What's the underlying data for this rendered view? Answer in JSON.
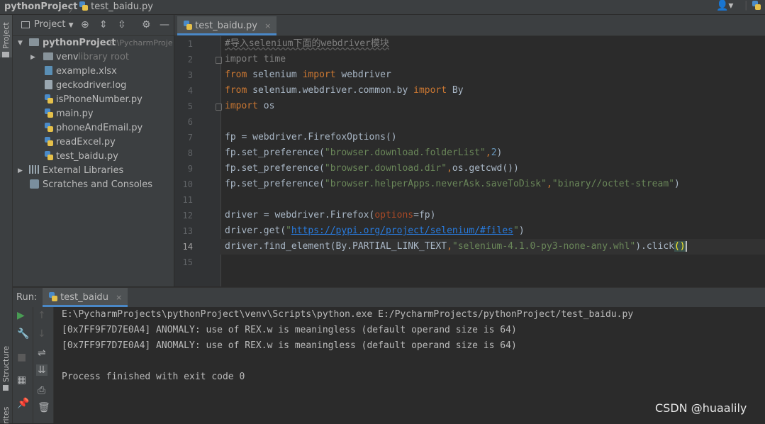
{
  "breadcrumb": {
    "project": "pythonProject",
    "file": "test_baidu.py"
  },
  "left_strip": {
    "project_tab": "Project",
    "structure_tab": "Structure",
    "favorites_tab": "rites"
  },
  "project_panel": {
    "title": "Project",
    "root": {
      "name": "pythonProject",
      "path": "E:\\PycharmProje"
    },
    "items": [
      {
        "name": "venv",
        "note": "library root",
        "type": "folder"
      },
      {
        "name": "example.xlsx",
        "type": "xlsx"
      },
      {
        "name": "geckodriver.log",
        "type": "file"
      },
      {
        "name": "isPhoneNumber.py",
        "type": "python"
      },
      {
        "name": "main.py",
        "type": "python"
      },
      {
        "name": "phoneAndEmail.py",
        "type": "python"
      },
      {
        "name": "readExcel.py",
        "type": "python"
      },
      {
        "name": "test_baidu.py",
        "type": "python"
      }
    ],
    "external_libraries": "External Libraries",
    "scratches": "Scratches and Consoles"
  },
  "editor": {
    "tab_label": "test_baidu.py",
    "tab_close": "×",
    "line_numbers": [
      "1",
      "2",
      "3",
      "4",
      "5",
      "6",
      "7",
      "8",
      "9",
      "10",
      "11",
      "12",
      "13",
      "14",
      "15"
    ],
    "current_line": "14",
    "code": {
      "l1": "#导入selenium下面的webdriver模块",
      "l2_kw": "import",
      "l2_mod": " time",
      "l3_kw1": "from",
      "l3_mod": " selenium ",
      "l3_kw2": "import",
      "l3_name": " webdriver",
      "l4_kw1": "from",
      "l4_mod": " selenium.webdriver.common.by ",
      "l4_kw2": "import",
      "l4_name": " By",
      "l5_kw": "import",
      "l5_mod": " os",
      "l7": "fp = webdriver.FirefoxOptions()",
      "l8_a": "fp.set_preference(",
      "l8_s": "\"browser.download.folderList\"",
      "l8_comma": ",",
      "l8_n": "2",
      "l8_end": ")",
      "l9_a": "fp.set_preference(",
      "l9_s": "\"browser.download.dir\"",
      "l9_comma": ",",
      "l9_b": "os.getcwd())",
      "l10_a": "fp.set_preference(",
      "l10_s1": "\"browser.helperApps.neverAsk.saveToDisk\"",
      "l10_comma": ",",
      "l10_s2": "\"binary//octet-stream\"",
      "l10_end": ")",
      "l12_a": "driver = webdriver.Firefox(",
      "l12_p": "options",
      "l12_b": "=fp)",
      "l13_a": "driver.get(",
      "l13_q1": "\"",
      "l13_url": "https://pypi.org/project/selenium/#files",
      "l13_q2": "\"",
      "l13_end": ")",
      "l14_a": "driver.find_element(By.PARTIAL_LINK_TEXT",
      "l14_comma": ",",
      "l14_s": "\"selenium-4.1.0-py3-none-any.whl\"",
      "l14_b": ").click",
      "l14_paren": "()"
    }
  },
  "run": {
    "label": "Run:",
    "tab": "test_baidu",
    "tab_close": "×",
    "output": [
      "E:\\PycharmProjects\\pythonProject\\venv\\Scripts\\python.exe E:/PycharmProjects/pythonProject/test_baidu.py",
      "[0x7FF9F7D7E0A4] ANOMALY: use of REX.w is meaningless (default operand size is 64)",
      "[0x7FF9F7D7E0A4] ANOMALY: use of REX.w is meaningless (default operand size is 64)",
      "",
      "Process finished with exit code 0"
    ]
  },
  "watermark": "CSDN @huaalily",
  "colors": {
    "accent": "#4a88c7",
    "keyword": "#cc7832",
    "string": "#6a8759",
    "background": "#2b2b2b"
  }
}
